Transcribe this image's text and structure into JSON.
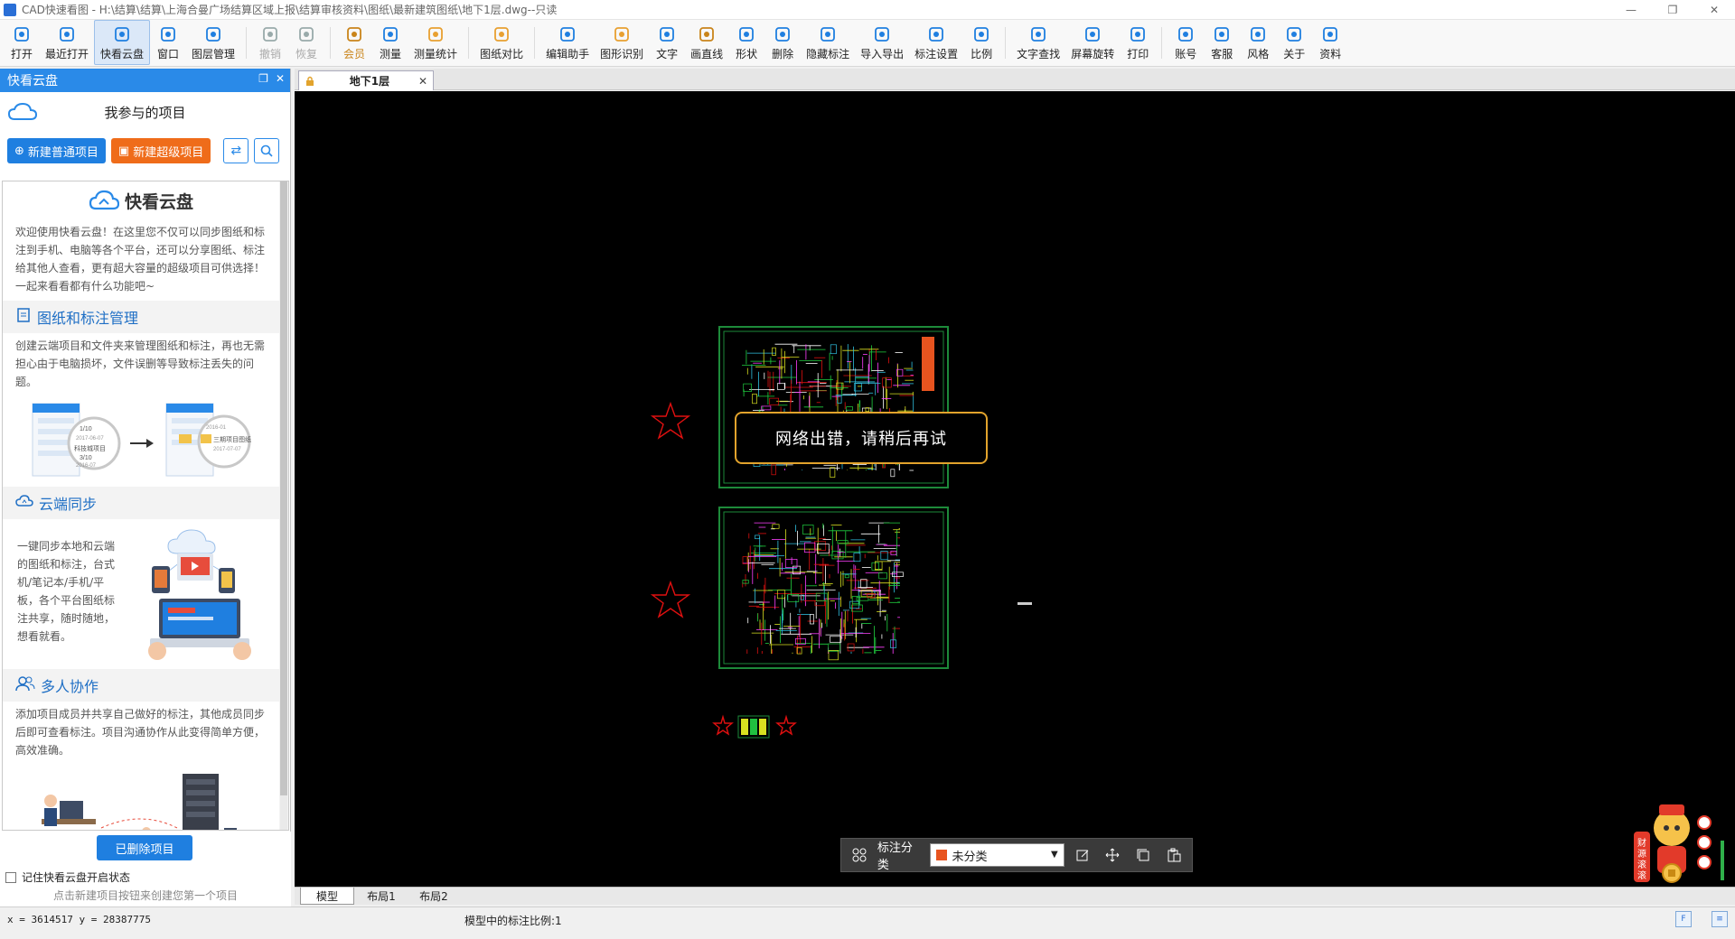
{
  "window": {
    "title": "CAD快速看图 - H:\\结算\\结算\\上海合曼广场结算区域上报\\结算审核资料\\图纸\\最新建筑图纸\\地下1层.dwg--只读"
  },
  "toolbar": {
    "items": [
      {
        "label": "打开",
        "icon": "folder-open-icon"
      },
      {
        "label": "最近打开",
        "icon": "history-icon"
      },
      {
        "label": "快看云盘",
        "icon": "cloud-icon"
      },
      {
        "label": "窗口",
        "icon": "window-icon"
      },
      {
        "label": "图层管理",
        "icon": "layers-icon"
      },
      {
        "label": "撤销",
        "icon": "undo-icon"
      },
      {
        "label": "恢复",
        "icon": "redo-icon"
      },
      {
        "label": "会员",
        "icon": "vip-icon"
      },
      {
        "label": "测量",
        "icon": "measure-icon"
      },
      {
        "label": "测量统计",
        "icon": "measure-stats-icon"
      },
      {
        "label": "图纸对比",
        "icon": "compare-icon"
      },
      {
        "label": "编辑助手",
        "icon": "edit-assistant-icon"
      },
      {
        "label": "图形识别",
        "icon": "shape-recognition-icon"
      },
      {
        "label": "文字",
        "icon": "text-icon"
      },
      {
        "label": "画直线",
        "icon": "line-icon"
      },
      {
        "label": "形状",
        "icon": "shape-icon"
      },
      {
        "label": "删除",
        "icon": "eraser-icon"
      },
      {
        "label": "隐藏标注",
        "icon": "hide-annotation-icon"
      },
      {
        "label": "导入导出",
        "icon": "import-export-icon"
      },
      {
        "label": "标注设置",
        "icon": "annotation-settings-icon"
      },
      {
        "label": "比例",
        "icon": "scale-icon"
      },
      {
        "label": "文字查找",
        "icon": "text-search-icon"
      },
      {
        "label": "屏幕旋转",
        "icon": "rotate-screen-icon"
      },
      {
        "label": "打印",
        "icon": "print-icon"
      },
      {
        "label": "账号",
        "icon": "account-icon"
      },
      {
        "label": "客服",
        "icon": "headset-icon"
      },
      {
        "label": "风格",
        "icon": "style-icon"
      },
      {
        "label": "关于",
        "icon": "info-icon"
      },
      {
        "label": "资料",
        "icon": "materials-icon"
      }
    ]
  },
  "cloud_panel": {
    "title": "快看云盘",
    "projects_label": "我参与的项目",
    "new_normal_label": "新建普通项目",
    "new_super_label": "新建超级项目",
    "brand_title": "快看云盘",
    "intro": "欢迎使用快看云盘！在这里您不仅可以同步图纸和标注到手机、电脑等各个平台，还可以分享图纸、标注给其他人查看，更有超大容量的超级项目可供选择！一起来看看都有什么功能吧~",
    "sections": [
      {
        "title": "图纸和标注管理",
        "text": "创建云端项目和文件夹来管理图纸和标注，再也无需担心由于电脑损坏，文件误删等导致标注丢失的问题。"
      },
      {
        "title": "云端同步",
        "text": "一键同步本地和云端的图纸和标注，台式机/笔记本/手机/平板，各个平台图纸标注共享，随时随地，想看就看。"
      },
      {
        "title": "多人协作",
        "text": "添加项目成员并共享自己做好的标注，其他成员同步后即可查看标注。项目沟通协作从此变得简单方便，高效准确。"
      }
    ],
    "illustration_labels": [
      "1/10",
      "2017-06-07",
      "科技城项目",
      "3/10",
      "2016-07",
      "三期项目图纸",
      "2017-07-07",
      "2016-01"
    ],
    "deleted_projects_label": "已删除项目",
    "remember_label": "记住快看云盘开启状态",
    "hint": "点击新建项目按钮来创建您第一个项目"
  },
  "document": {
    "tab_name": "地下1层"
  },
  "canvas": {
    "toast": "网络出错，请稍后再试",
    "annotation_bar": {
      "category_label": "标注分类",
      "selected_category": "未分类",
      "category_color": "#e8541f"
    },
    "mascot_text": "财源滚滚"
  },
  "layout_tabs": [
    "模型",
    "布局1",
    "布局2"
  ],
  "status": {
    "coords": "x = 3614517 y = 28387775",
    "scale": "模型中的标注比例:1"
  },
  "colors": {
    "accent": "#2a8ae8",
    "orange": "#ef6c1a",
    "cad_green": "#1d8a3a",
    "toast_border": "#e2a32c"
  }
}
